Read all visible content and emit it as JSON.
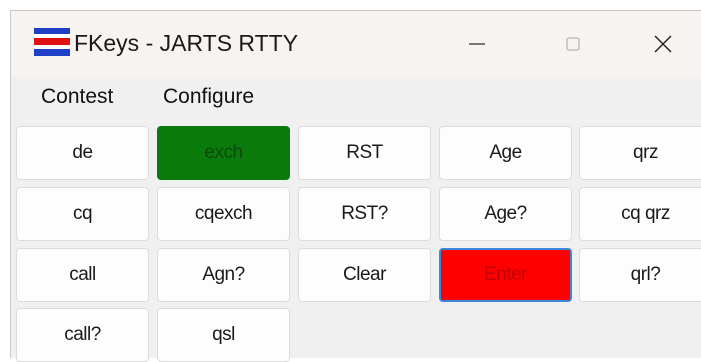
{
  "window": {
    "title": "FKeys - JARTS RTTY",
    "colors": {
      "accent_green": "#0a7a0a",
      "accent_red": "#ff0000"
    }
  },
  "menu": {
    "items": [
      "Contest",
      "Configure"
    ]
  },
  "fkeys": {
    "rows": [
      [
        "de",
        "exch",
        "RST",
        "Age",
        "qrz"
      ],
      [
        "cq",
        "cqexch",
        "RST?",
        "Age?",
        "cq qrz"
      ],
      [
        "call",
        "Agn?",
        "Clear",
        "Enter",
        "qrl?"
      ],
      [
        "call?",
        "qsl"
      ]
    ]
  }
}
